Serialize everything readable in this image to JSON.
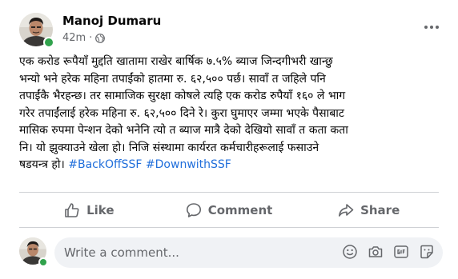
{
  "post": {
    "author": "Manoj Dumaru",
    "time": "42m",
    "privacy_separator": "·",
    "privacy_icon": "globe-icon",
    "more_icon": "more-options-icon",
    "text_lines": [
      "एक करोड रूपैयाँ मुद्दति खातामा राखेर बार्षिक ७.५% ब्याज जिन्दगीभरी खान्छु",
      "भन्यो भने हरेक महिना तपाईंको हातमा रु. ६२,५०० पर्छ। सावाँ त जहिले पनि",
      "तपाईंकै भैरहन्छ। तर सामाजिक सुरक्षा कोषले त्यहि एक करोड रुपैयाँ १६० ले भाग",
      "गरेर तपाईंलाई हरेक महिना रु. ६२,५०० दिने रे। कुरा घुमाएर जम्मा भएके पैसाबाट",
      "मासिक रुपमा पेन्शन देको भनेनि त्यो त ब्याज मात्रै देको देखियो सावाँ त कता कता",
      "नि।  यो झुक्याउने खेला हो। निजि संस्थामा कार्यरत कर्मचारीहरूलाई फसाउने"
    ],
    "last_line_text": "षडयन्त्र हो।",
    "hashtags": [
      "#BackOffSSF",
      "#DownwithSSF"
    ],
    "accent_color": "#216fdb",
    "online_color": "#31a24c"
  },
  "actions": [
    {
      "label": "Like",
      "icon": "like-icon"
    },
    {
      "label": "Comment",
      "icon": "comment-icon"
    },
    {
      "label": "Share",
      "icon": "share-icon"
    }
  ],
  "comment": {
    "placeholder": "Write a comment...",
    "icons": [
      "emoji-icon",
      "camera-icon",
      "gif-icon",
      "sticker-icon"
    ]
  }
}
